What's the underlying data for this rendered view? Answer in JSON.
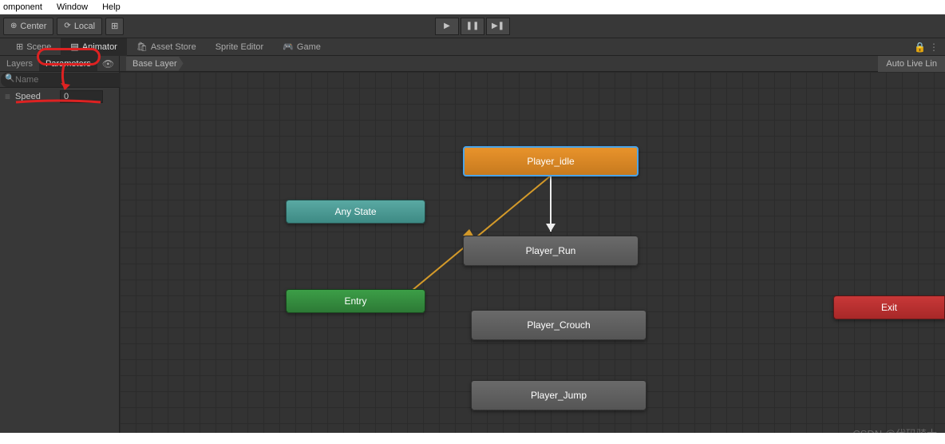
{
  "menubar": {
    "items": [
      "omponent",
      "Window",
      "Help"
    ]
  },
  "toolbar": {
    "center": "Center",
    "local": "Local"
  },
  "tabs": {
    "scene": "Scene",
    "animator": "Animator",
    "asset_store": "Asset Store",
    "sprite_editor": "Sprite Editor",
    "game": "Game"
  },
  "side": {
    "layers": "Layers",
    "parameters": "Parameters",
    "search_placeholder": "Name",
    "params": [
      {
        "name": "Speed",
        "value": "0"
      }
    ]
  },
  "breadcrumb": {
    "base": "Base Layer"
  },
  "autolive": "Auto Live Lin",
  "nodes": {
    "player_idle": "Player_idle",
    "any_state": "Any State",
    "player_run": "Player_Run",
    "entry": "Entry",
    "player_crouch": "Player_Crouch",
    "player_jump": "Player_Jump",
    "exit": "Exit"
  },
  "watermark": "CSDN @代码骑士"
}
